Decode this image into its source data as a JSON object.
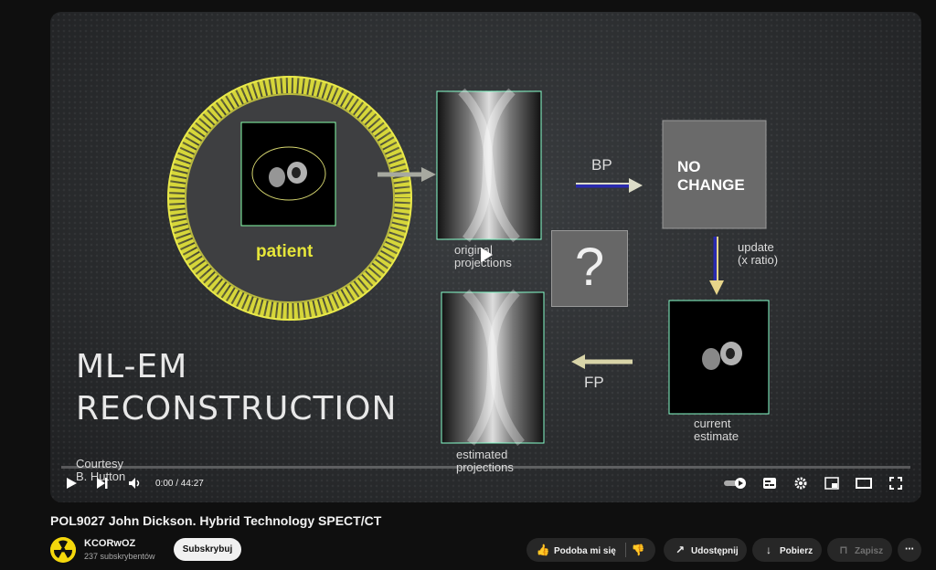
{
  "video": {
    "title": "POL9027 John Dickson. Hybrid Technology SPECT/CT",
    "time_current": "0:00",
    "time_total": "44:27",
    "time_display": "0:00 / 44:27"
  },
  "slide": {
    "title_line1": "ML-EM",
    "title_line2": "RECONSTRUCTION",
    "courtesy_line1": "Courtesy",
    "courtesy_line2": "B. Hutton",
    "patient_label": "patient",
    "original_line1": "original",
    "original_line2": "projections",
    "bp_label": "BP",
    "no_change_line1": "NO",
    "no_change_line2": "CHANGE",
    "update_line1": "update",
    "update_line2": "(x ratio)",
    "question_mark": "?",
    "fp_label": "FP",
    "current_line1": "current",
    "current_line2": "estimate",
    "estimated_line1": "estimated",
    "estimated_line2": "projections"
  },
  "channel": {
    "name": "KCORwOZ",
    "subscribers": "237 subskrybentów",
    "subscribe_label": "Subskrybuj"
  },
  "actions": {
    "like_label": "Podoba mi się",
    "share_label": "Udostępnij",
    "download_label": "Pobierz",
    "save_label": "Zapisz"
  },
  "icons": {
    "play": "play-icon",
    "next": "next-icon",
    "volume": "volume-icon",
    "autoplay": "autoplay-toggle-icon",
    "subtitles": "subtitles-icon",
    "settings": "gear-icon",
    "miniplayer": "miniplayer-icon",
    "theater": "theater-icon",
    "fullscreen": "fullscreen-icon",
    "like": "thumbs-up-icon",
    "dislike": "thumbs-down-icon",
    "share": "share-icon",
    "download": "download-icon",
    "save": "bookmark-icon",
    "more": "more-icon"
  }
}
